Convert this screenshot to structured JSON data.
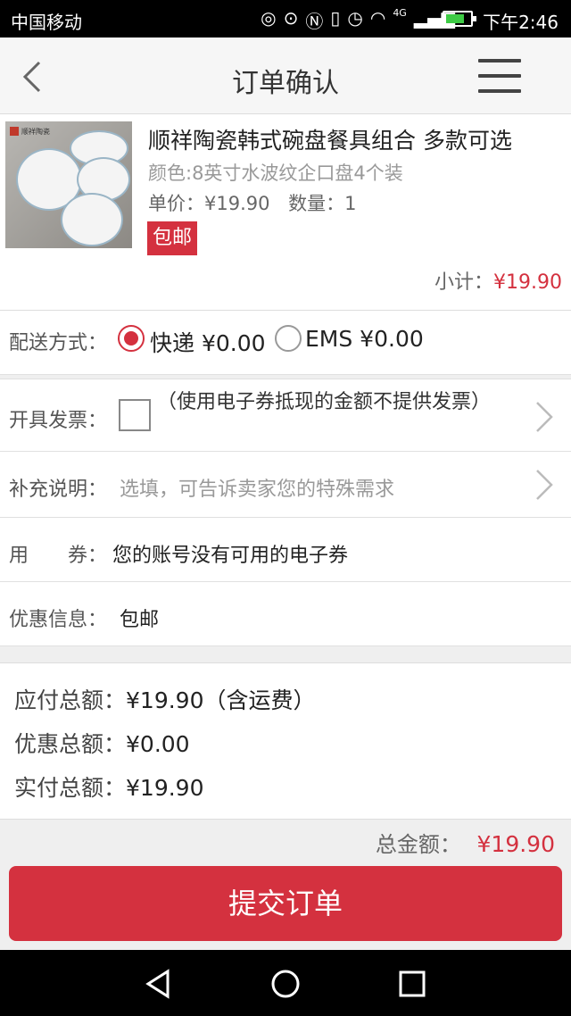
{
  "status_bar": {
    "carrier": "中国移动",
    "network": "4G",
    "time": "下午2:46"
  },
  "header": {
    "title": "订单确认"
  },
  "product": {
    "name": "顺祥陶瓷韩式碗盘餐具组合 多款可选",
    "spec": "颜色:8英寸水波纹企口盘4个装",
    "price_label": "单价：¥19.90",
    "qty_label": "数量：1",
    "badge": "包邮",
    "thumb_brand": "顺祥陶瓷",
    "subtotal_label": "小计：",
    "subtotal_value": "¥19.90"
  },
  "delivery": {
    "label": "配送方式：",
    "options": [
      {
        "label": "快递 ¥0.00",
        "selected": true
      },
      {
        "label": "EMS ¥0.00",
        "selected": false
      }
    ]
  },
  "invoice": {
    "label": "开具发票：",
    "note": "（使用电子券抵现的金额不提供发票）"
  },
  "remark": {
    "label": "补充说明：",
    "placeholder": "选填，可告诉卖家您的特殊需求"
  },
  "coupon": {
    "label": "用　　券：",
    "value": "您的账号没有可用的电子券"
  },
  "promotion": {
    "label": "优惠信息：",
    "value": "包邮"
  },
  "summary": {
    "payable_label": "应付总额：",
    "payable_value": "¥19.90（含运费）",
    "discount_label": "优惠总额：",
    "discount_value": "¥0.00",
    "actual_label": "实付总额：",
    "actual_value": "¥19.90"
  },
  "total": {
    "label": "总金额：",
    "value": "¥19.90"
  },
  "submit": {
    "label": "提交订单"
  },
  "colors": {
    "accent": "#d4313f"
  }
}
